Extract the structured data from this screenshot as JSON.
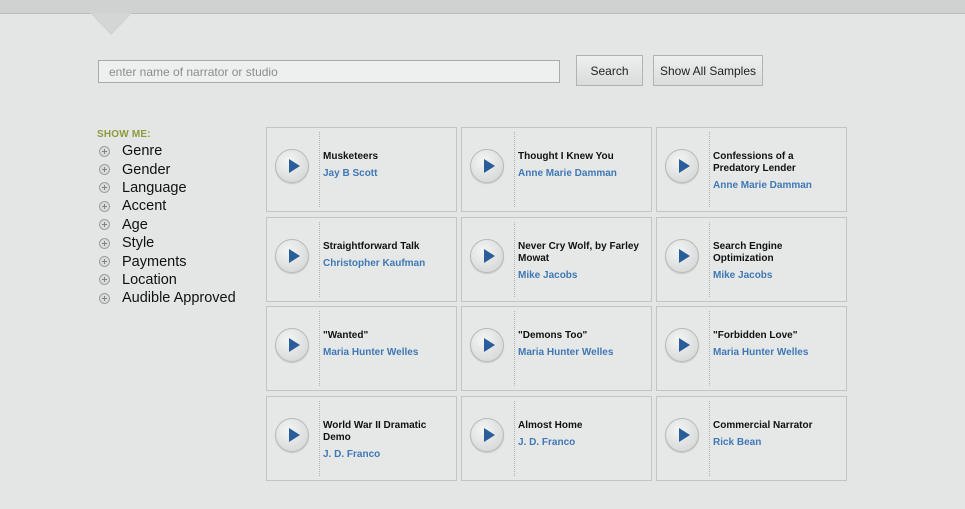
{
  "search": {
    "placeholder": "enter name of narrator or studio",
    "value": "",
    "search_label": "Search",
    "show_all_label": "Show All Samples"
  },
  "sidebar": {
    "title": "SHOW ME:",
    "filters": [
      {
        "label": "Genre",
        "icon": "plus-circle-icon"
      },
      {
        "label": "Gender",
        "icon": "plus-circle-icon"
      },
      {
        "label": "Language",
        "icon": "plus-circle-icon"
      },
      {
        "label": "Accent",
        "icon": "plus-circle-icon"
      },
      {
        "label": "Age",
        "icon": "plus-circle-icon"
      },
      {
        "label": "Style",
        "icon": "plus-circle-icon"
      },
      {
        "label": "Payments",
        "icon": "plus-circle-icon"
      },
      {
        "label": "Location",
        "icon": "plus-circle-icon"
      },
      {
        "label": "Audible Approved",
        "icon": "plus-circle-icon"
      }
    ]
  },
  "samples": [
    {
      "title": "Musketeers",
      "narrator": "Jay B Scott"
    },
    {
      "title": "Thought I Knew You",
      "narrator": "Anne Marie Damman"
    },
    {
      "title": "Confessions of a Predatory Lender",
      "narrator": "Anne Marie Damman"
    },
    {
      "title": "Straightforward Talk",
      "narrator": "Christopher Kaufman"
    },
    {
      "title": "Never Cry Wolf, by Farley Mowat",
      "narrator": "Mike Jacobs"
    },
    {
      "title": "Search Engine Optimization",
      "narrator": "Mike Jacobs"
    },
    {
      "title": "\"Wanted\"",
      "narrator": "Maria Hunter Welles"
    },
    {
      "title": "\"Demons Too\"",
      "narrator": "Maria Hunter Welles"
    },
    {
      "title": "\"Forbidden Love\"",
      "narrator": "Maria Hunter Welles"
    },
    {
      "title": "World War II Dramatic Demo",
      "narrator": "J. D. Franco"
    },
    {
      "title": "Almost Home",
      "narrator": "J. D. Franco"
    },
    {
      "title": "Commercial Narrator",
      "narrator": "Rick Bean"
    }
  ],
  "colors": {
    "accent_link": "#3f78b5",
    "showme_label": "#8f9a3c",
    "play_arrow": "#2a5e9a"
  },
  "icons": {
    "play": "play-icon",
    "filter": "plus-circle-icon"
  }
}
